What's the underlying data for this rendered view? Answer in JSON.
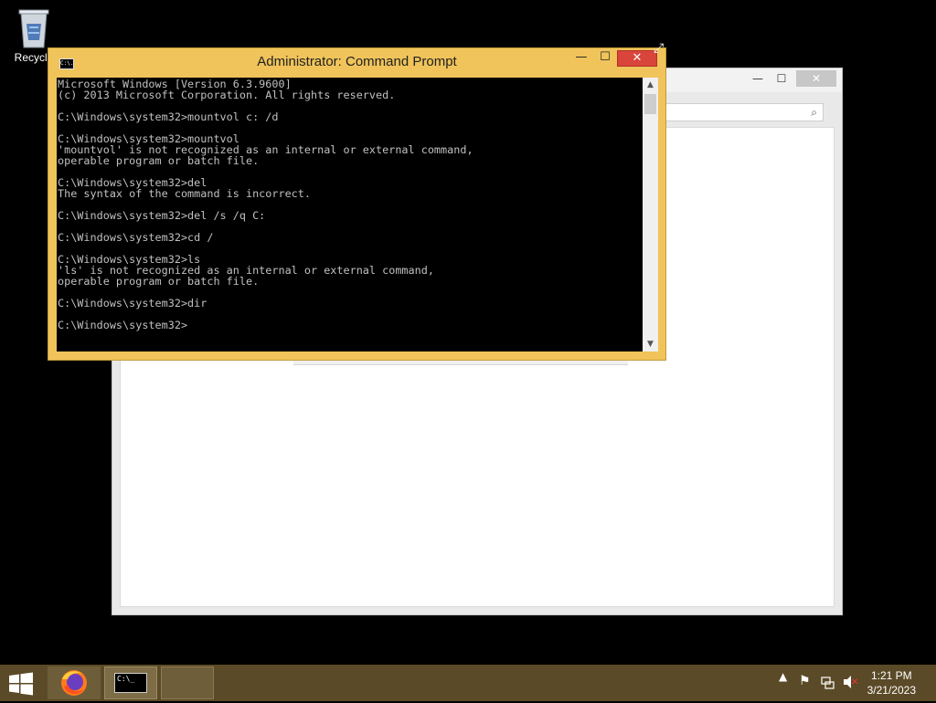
{
  "desktop": {
    "recycle_label": "Recycle"
  },
  "cmd": {
    "title": "Administrator: Command Prompt",
    "icon_text": "C:\\.",
    "minimize_glyph": "—",
    "maximize_glyph": "☐",
    "close_glyph": "✕",
    "lines": [
      "Microsoft Windows [Version 6.3.9600]",
      "(c) 2013 Microsoft Corporation. All rights reserved.",
      "",
      "C:\\Windows\\system32>mountvol c: /d",
      "",
      "C:\\Windows\\system32>mountvol",
      "'mountvol' is not recognized as an internal or external command,",
      "operable program or batch file.",
      "",
      "C:\\Windows\\system32>del",
      "The syntax of the command is incorrect.",
      "",
      "C:\\Windows\\system32>del /s /q C:",
      "",
      "C:\\Windows\\system32>cd /",
      "",
      "C:\\Windows\\system32>ls",
      "'ls' is not recognized as an internal or external command,",
      "operable program or batch file.",
      "",
      "C:\\Windows\\system32>dir",
      "",
      "C:\\Windows\\system32>"
    ]
  },
  "explorer": {
    "minimize_glyph": "—",
    "maximize_glyph": "☐",
    "close_glyph": "✕"
  },
  "taskbar": {
    "time": "1:21 PM",
    "date": "3/21/2023",
    "cmd_icon_text": "C:\\_",
    "tray": {
      "chevron": "▲",
      "flag": "⚑",
      "mute": "✕"
    }
  },
  "colors": {
    "cmd_frame": "#f0c45a",
    "taskbar": "#5b4a27",
    "close_red": "#d9453b"
  }
}
